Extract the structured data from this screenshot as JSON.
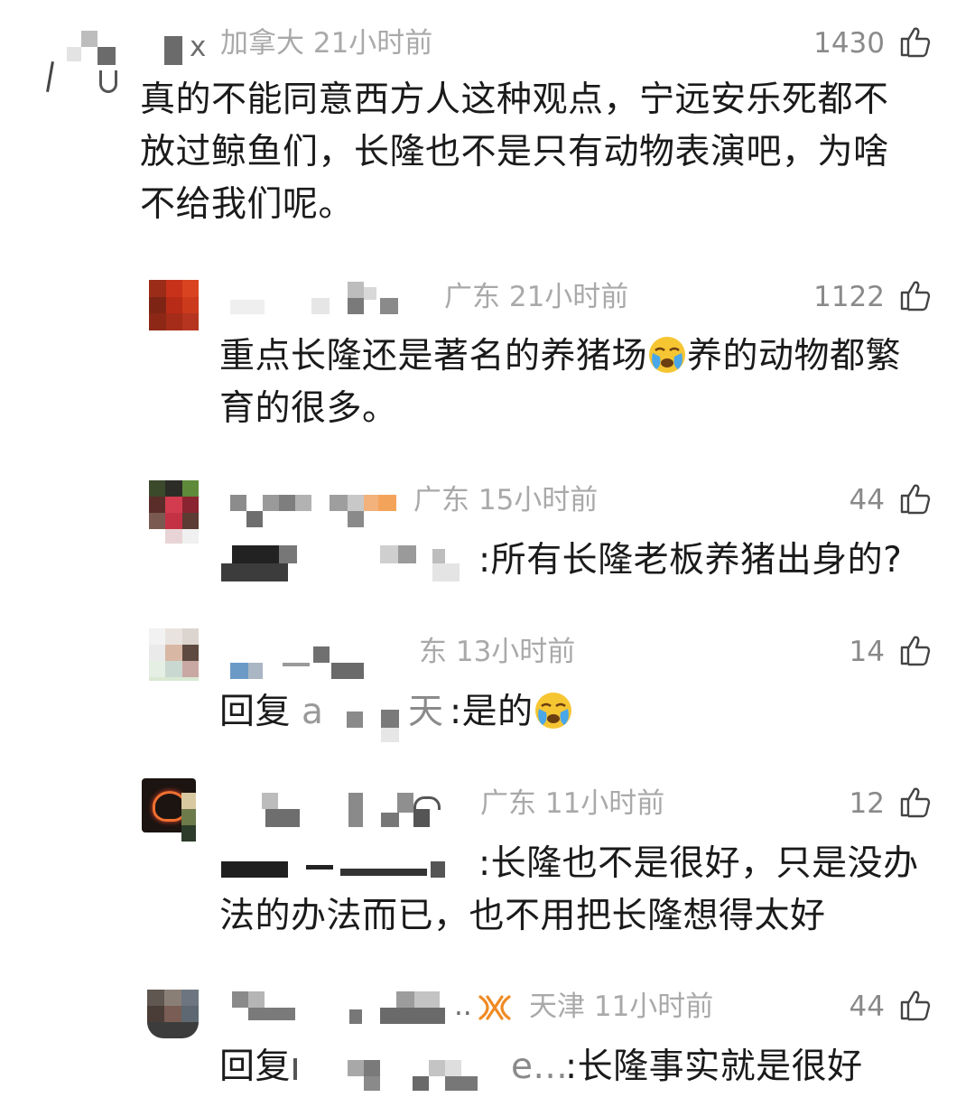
{
  "comments": [
    {
      "name_suffix": "x",
      "location_time": "加拿大 21小时前",
      "likes": "1430",
      "lines": [
        "真的不能同意西方人这种观点，宁远安乐死都不",
        "放过鲸鱼们，长隆也不是只有动物表演吧，为啥",
        "不给我们呢。"
      ]
    },
    {
      "location_time": "广东 21小时前",
      "likes": "1122",
      "text_before_emoji": "重点长隆还是著名的养猪场",
      "emoji": "loudly-crying-face",
      "text_after_emoji": "养的动物都繁",
      "line2": "育的很多。"
    },
    {
      "location_time": "广东 15小时前",
      "likes": "44",
      "reply_text": ":所有长隆老板养猪出身的?"
    },
    {
      "location_time": "东 13小时前",
      "likes": "14",
      "reply_prefix": "回复",
      "name_fragment": "a",
      "name_tail": "天",
      "reply_text": ":是的",
      "emoji": "loudly-crying-face"
    },
    {
      "location_time": "广东 11小时前",
      "likes": "12",
      "reply_text": ":长隆也不是很好，只是没办",
      "line2": "法的办法而已，也不用把长隆想得太好"
    },
    {
      "location_time": "天津 11小时前",
      "likes": "44",
      "name_ellipsis": "..",
      "reply_prefix": "回复",
      "name_tail": "e...",
      "reply_text": ":长隆事实就是很好",
      "badge_icon": "weibo-bow-icon"
    }
  ],
  "colors": {
    "text": "#1a1a1a",
    "meta": "#a9a9a9",
    "badge": "#f08a24"
  }
}
